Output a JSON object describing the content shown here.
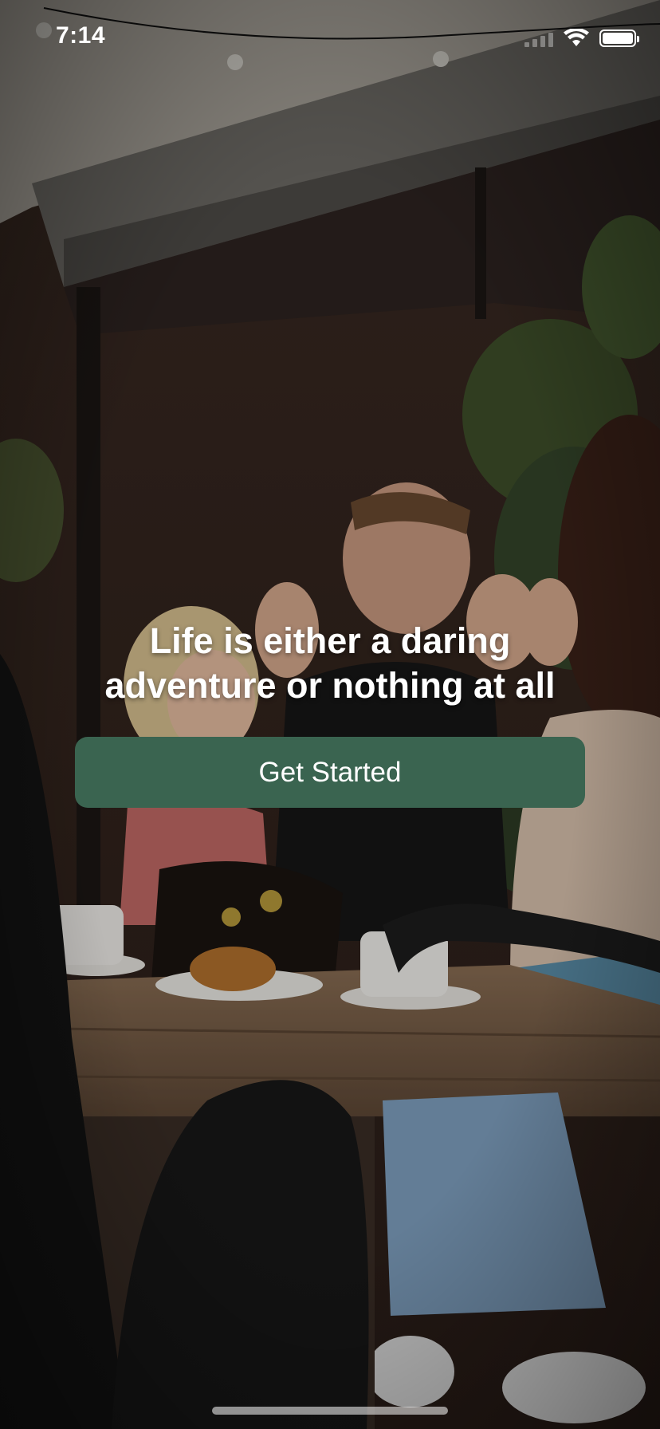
{
  "status_bar": {
    "time": "7:14"
  },
  "hero": {
    "headline": "Life is either a daring adventure or nothing at all"
  },
  "actions": {
    "get_started_label": "Get Started"
  },
  "colors": {
    "button_background": "#3a6450",
    "button_text": "#ffffff",
    "headline_text": "#ffffff"
  },
  "icons": {
    "signal": "cellular-signal-icon",
    "wifi": "wifi-icon",
    "battery": "battery-icon"
  }
}
